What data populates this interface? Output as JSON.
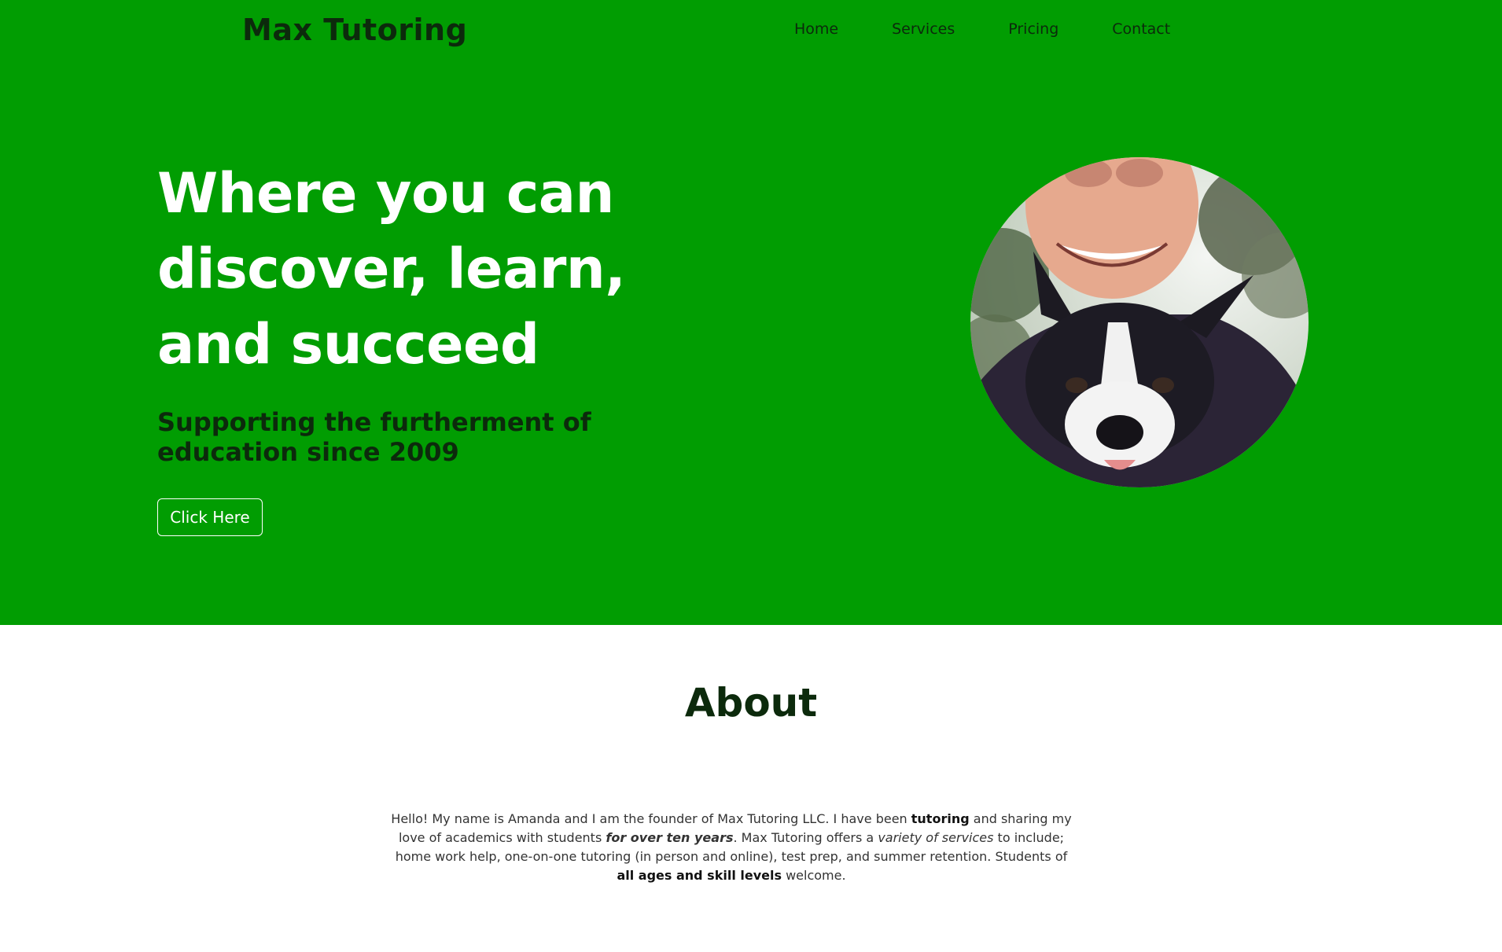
{
  "header": {
    "brand": "Max Tutoring",
    "nav": [
      "Home",
      "Services",
      "Pricing",
      "Contact"
    ]
  },
  "hero": {
    "headline": "Where you can discover, learn, and succeed",
    "subheadline": "Supporting the furtherment of education since 2009",
    "cta_label": "Click Here",
    "photo": "smiling-person-with-black-and-white-dog"
  },
  "about": {
    "title": "About",
    "p1": "Hello! My name is Amanda and I am the founder of Max Tutoring LLC. I have been ",
    "p2_bold": "tutoring",
    "p3": " and sharing my love of academics with students ",
    "p4_bolditalic": "for over ten years",
    "p5": ". Max Tutoring offers a ",
    "p6_italic": "variety of services",
    "p7": " to include; home work help, one-on-one tutoring (in person and online), test prep, and summer retention. Students of ",
    "p8_bold": "all ages and skill levels",
    "p9": " welcome."
  },
  "colors": {
    "hero_green": "#019d02",
    "dark_text": "#0c2a0c",
    "white": "#ffffff"
  }
}
